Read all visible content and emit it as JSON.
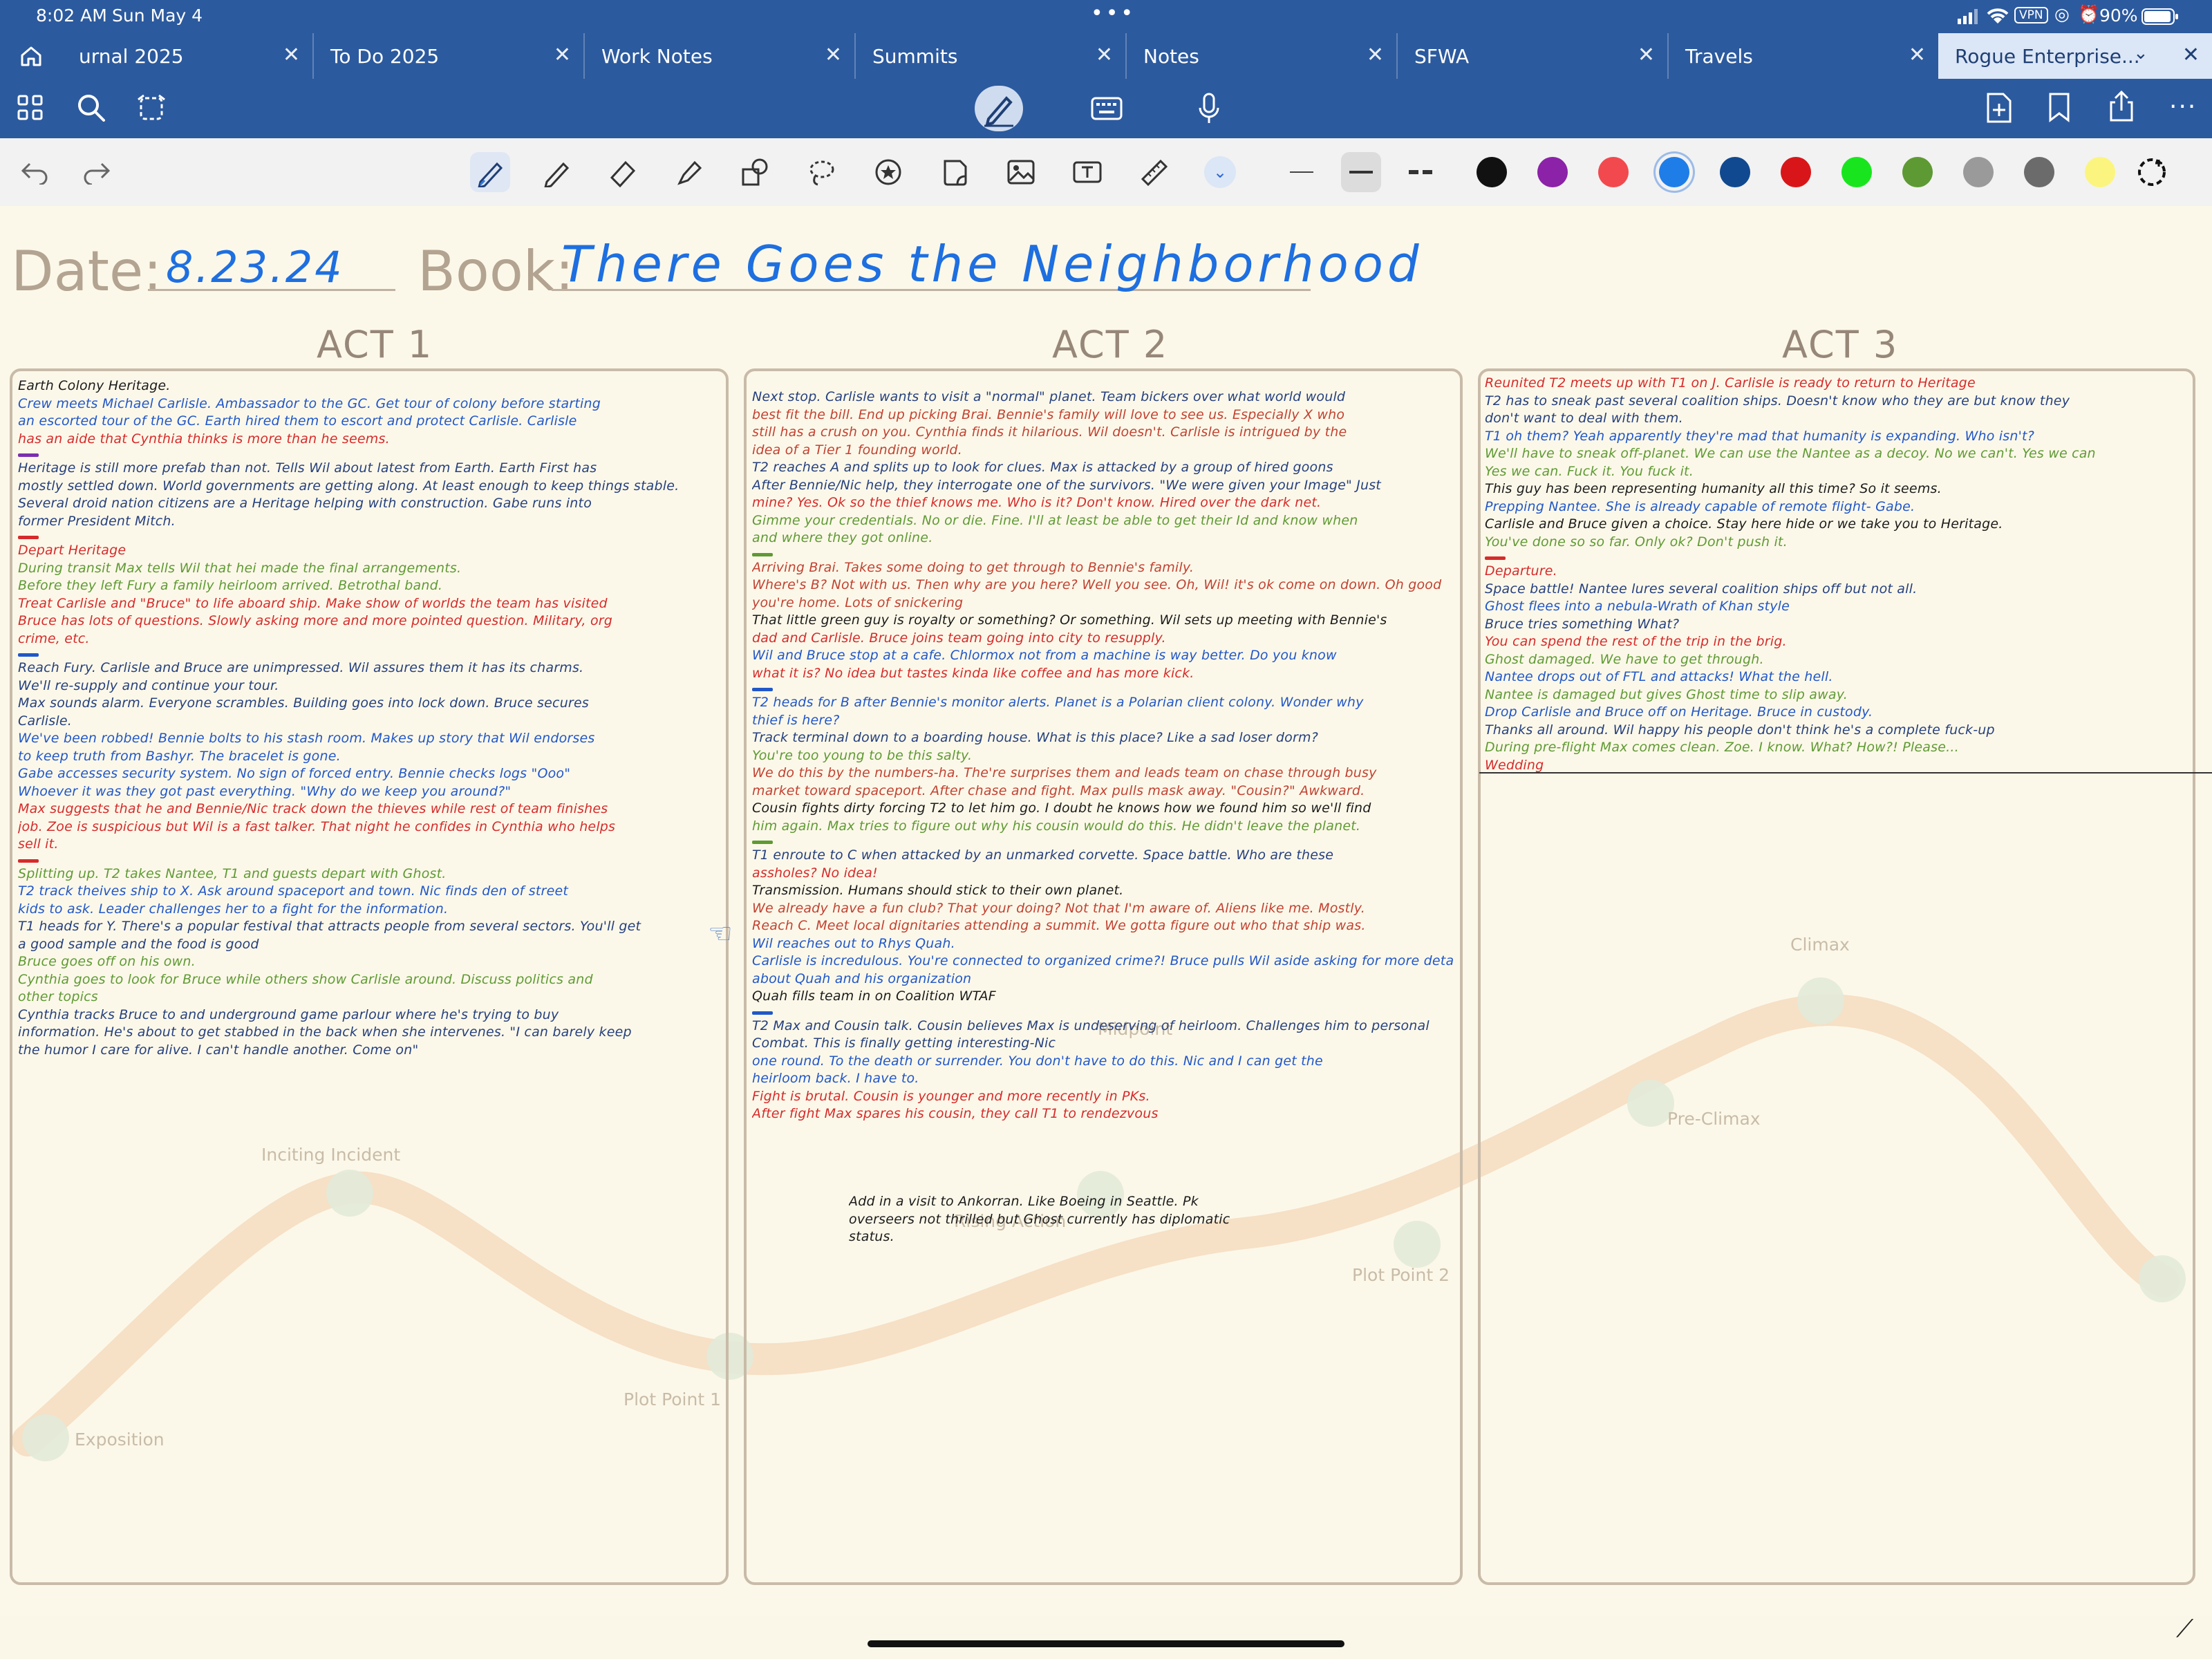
{
  "status": {
    "time": "8:02 AM",
    "date": "Sun May 4",
    "vpn": "VPN",
    "battery": "90%"
  },
  "tabs": [
    {
      "label": "urnal 2025"
    },
    {
      "label": "To Do 2025"
    },
    {
      "label": "Work Notes"
    },
    {
      "label": "Summits"
    },
    {
      "label": "Notes"
    },
    {
      "label": "SFWA"
    },
    {
      "label": "Travels"
    },
    {
      "label": "Rogue Enterprise..."
    }
  ],
  "colors": {
    "swatches": [
      "#111111",
      "#8b22a8",
      "#f2494e",
      "#1f7de8",
      "#10498f",
      "#d81619",
      "#19e51f",
      "#5e9a33",
      "#9a9a9a",
      "#6b6b6b",
      "#fbf57f"
    ]
  },
  "page": {
    "date_label": "Date:",
    "date_value": "8.23.24",
    "book_label": "Book:",
    "book_value": "There Goes the Neighborhood",
    "acts": [
      {
        "title": "ACT 1"
      },
      {
        "title": "ACT 2"
      },
      {
        "title": "ACT 3"
      }
    ],
    "arc_labels": {
      "exposition": "Exposition",
      "inciting": "Inciting Incident",
      "plot1": "Plot Point 1",
      "rising": "Rising Action",
      "midpoint": "Midpoint",
      "plot2": "Plot Point 2",
      "preclimax": "Pre-Climax",
      "climax": "Climax"
    }
  },
  "act1_lines": [
    {
      "c": "k",
      "t": "Earth Colony Heritage."
    },
    {
      "c": "b",
      "t": "Crew meets Michael Carlisle. Ambassador to the GC. Get tour of colony before starting"
    },
    {
      "c": "b",
      "t": "an escorted tour of the GC. Earth hired them to escort and protect Carlisle. Carlisle"
    },
    {
      "c": "r",
      "t": "has an aide that Cynthia thinks is more than he seems."
    },
    {
      "d": "#7b2fb0"
    },
    {
      "c": "n",
      "t": "Heritage is still more prefab than not. Tells Wil about latest from Earth. Earth First has"
    },
    {
      "c": "n",
      "t": "mostly settled down. World governments are getting along. At least enough to keep things stable."
    },
    {
      "c": "n",
      "t": "Several droid nation citizens are a Heritage helping with construction. Gabe runs into"
    },
    {
      "c": "n",
      "t": "former President Mitch."
    },
    {
      "d": "#d62b2b"
    },
    {
      "c": "r",
      "t": "Depart Heritage"
    },
    {
      "c": "g",
      "t": "During transit Max tells Wil that hei made the final arrangements."
    },
    {
      "c": "g",
      "t": "Before they left Fury a family heirloom arrived. Betrothal band."
    },
    {
      "c": "r",
      "t": "Treat Carlisle and \"Bruce\" to life aboard ship. Make show of worlds the team has visited"
    },
    {
      "c": "r",
      "t": "Bruce has lots of questions. Slowly asking more and more pointed question. Military, org"
    },
    {
      "c": "r",
      "t": "crime, etc."
    },
    {
      "d": "#2157c9"
    },
    {
      "c": "n",
      "t": "Reach Fury. Carlisle and Bruce are unimpressed. Wil assures them it has its charms."
    },
    {
      "c": "n",
      "t": "We'll re-supply and continue your tour."
    },
    {
      "c": "n",
      "t": "Max sounds alarm. Everyone scrambles. Building goes into lock down. Bruce secures"
    },
    {
      "c": "n",
      "t": "Carlisle."
    },
    {
      "c": "b",
      "t": "We've been robbed! Bennie bolts to his stash room. Makes up story that Wil endorses"
    },
    {
      "c": "b",
      "t": "to keep truth from Bashyr. The bracelet is gone."
    },
    {
      "c": "b",
      "t": "Gabe accesses security system. No sign of forced entry. Bennie checks logs \"Ooo\""
    },
    {
      "c": "b",
      "t": "Whoever it was they got past everything. \"Why do we keep you around?\""
    },
    {
      "c": "r",
      "t": "Max suggests that he and Bennie/Nic track down the thieves while rest of team finishes"
    },
    {
      "c": "r",
      "t": "job. Zoe is suspicious but Wil is a fast talker. That night he confides in Cynthia who helps"
    },
    {
      "c": "r",
      "t": "sell it."
    },
    {
      "d": "#d62b2b"
    },
    {
      "c": "g",
      "t": "Splitting up. T2 takes Nantee, T1 and guests depart with Ghost."
    },
    {
      "c": "b",
      "t": "T2 track theives ship to X. Ask around spaceport and town. Nic finds den of street"
    },
    {
      "c": "b",
      "t": "kids to ask. Leader challenges her to a fight for the information."
    },
    {
      "c": "n",
      "t": "T1 heads for Y. There's a popular festival that attracts people from several sectors. You'll get"
    },
    {
      "c": "n",
      "t": "a good sample and the food is good"
    },
    {
      "c": "g",
      "t": "Bruce goes off on his own."
    },
    {
      "c": "g",
      "t": "Cynthia goes to look for Bruce while others show Carlisle around. Discuss politics and"
    },
    {
      "c": "g",
      "t": "other topics"
    },
    {
      "c": "n",
      "t": "Cynthia tracks Bruce to and underground game parlour where he's trying to buy"
    },
    {
      "c": "n",
      "t": "information. He's about to get stabbed in the back when she intervenes. \"I can barely keep"
    },
    {
      "c": "n",
      "t": "the humor I care for alive. I can't handle another. Come on\""
    }
  ],
  "act2_lines": [
    {
      "c": "n",
      "t": "Next stop. Carlisle wants to visit a \"normal\" planet. Team bickers over what world would"
    },
    {
      "c": "m",
      "t": "best fit the bill. End up picking Brai. Bennie's family will love to see us. Especially X who"
    },
    {
      "c": "m",
      "t": "still has a crush on you. Cynthia finds it hilarious. Wil doesn't. Carlisle is intrigued by the"
    },
    {
      "c": "m",
      "t": "idea of a Tier 1 founding world."
    },
    {
      "c": "n",
      "t": "T2 reaches A and splits up to look for clues. Max is attacked by a group of hired goons"
    },
    {
      "c": "n",
      "t": "After Bennie/Nic help, they interrogate one of the survivors. \"We were given your Image\" Just"
    },
    {
      "c": "r",
      "t": "mine? Yes. Ok so the thief knows me. Who is it? Don't know. Hired over the dark net."
    },
    {
      "c": "g",
      "t": "Gimme your credentials. No or die. Fine. I'll at least be able to get their Id and know when"
    },
    {
      "c": "g",
      "t": "and where they got online."
    },
    {
      "d": "#5f9a34"
    },
    {
      "c": "m",
      "t": "Arriving Brai. Takes some doing to get through to Bennie's family."
    },
    {
      "c": "m",
      "t": "Where's B? Not with us. Then why are you here? Well you see. Oh, Wil! it's ok come on down. Oh good"
    },
    {
      "c": "m",
      "t": "you're home. Lots of snickering"
    },
    {
      "c": "k",
      "t": "That little green guy is royalty or something? Or something. Wil sets up meeting with Bennie's"
    },
    {
      "c": "r",
      "t": "dad and Carlisle. Bruce joins team going into city to resupply."
    },
    {
      "c": "b",
      "t": "Wil and Bruce stop at a cafe. Chlormox not from a machine is way better. Do you know"
    },
    {
      "c": "r",
      "t": "what it is? No idea but tastes kinda like coffee and has more kick."
    },
    {
      "d": "#2157c9"
    },
    {
      "c": "b",
      "t": "T2 heads for B after Bennie's monitor alerts. Planet is a Polarian client colony. Wonder why"
    },
    {
      "c": "b",
      "t": "thief is here?"
    },
    {
      "c": "n",
      "t": "Track terminal down to a boarding house. What is this place? Like a sad loser dorm?"
    },
    {
      "c": "g",
      "t": "You're too young to be this salty."
    },
    {
      "c": "m",
      "t": "We do this by the numbers-ha. The're surprises them and leads team on chase through busy"
    },
    {
      "c": "m",
      "t": "market toward spaceport.   After chase and fight. Max pulls mask away. \"Cousin?\" Awkward."
    },
    {
      "c": "k",
      "t": "Cousin fights dirty forcing T2 to let him go. I doubt he knows how we found him so we'll find"
    },
    {
      "c": "g",
      "t": "him again. Max tries to figure out why his cousin would do this. He didn't leave the planet."
    },
    {
      "d": "#5f9a34"
    },
    {
      "c": "n",
      "t": "T1 enroute to C when attacked by an unmarked corvette. Space battle. Who are these"
    },
    {
      "c": "r",
      "t": "assholes? No idea!"
    },
    {
      "c": "k",
      "t": "Transmission. Humans should stick to their own planet."
    },
    {
      "c": "m",
      "t": "We already have a fun club? That your doing? Not that I'm aware of. Aliens like me. Mostly."
    },
    {
      "c": "m",
      "t": "Reach C. Meet local dignitaries attending a summit. We gotta figure out who that ship was."
    },
    {
      "c": "b",
      "t": "Wil reaches out to Rhys Quah."
    },
    {
      "c": "b",
      "t": "Carlisle is incredulous. You're connected to organized crime?! Bruce pulls Wil aside asking for more details"
    },
    {
      "c": "b",
      "t": "about Quah and his organization"
    },
    {
      "c": "k",
      "t": "Quah fills team in on Coalition WTAF"
    },
    {
      "d": "#2157c9"
    },
    {
      "c": "n",
      "t": "T2 Max and Cousin talk. Cousin believes Max is undeserving of heirloom. Challenges him to personal"
    },
    {
      "c": "n",
      "t": "Combat. This is finally getting interesting-Nic"
    },
    {
      "c": "b",
      "t": "one round. To the death or surrender. You don't have to do this. Nic and I can get the"
    },
    {
      "c": "b",
      "t": "heirloom back. I have to."
    },
    {
      "c": "r",
      "t": "Fight is brutal. Cousin is younger and more recently in PKs."
    },
    {
      "c": "r",
      "t": "After fight Max spares his cousin, they call T1 to rendezvous"
    }
  ],
  "act2_bottom_note": [
    {
      "c": "k",
      "t": "Add in a visit to Ankorran. Like Boeing in Seattle. Pk"
    },
    {
      "c": "k",
      "t": "overseers not thrilled but Ghost currently has diplomatic"
    },
    {
      "c": "k",
      "t": "status."
    }
  ],
  "act3_lines": [
    {
      "c": "r",
      "t": "Reunited T2 meets up with T1 on J. Carlisle is ready to return to Heritage"
    },
    {
      "c": "n",
      "t": "T2 has to sneak past several coalition ships. Doesn't know who they are but know they"
    },
    {
      "c": "n",
      "t": "don't want to deal with them."
    },
    {
      "c": "b",
      "t": "T1 oh them? Yeah apparently they're mad that humanity is expanding. Who isn't?"
    },
    {
      "c": "g",
      "t": "We'll have to sneak off-planet. We can use the Nantee as a decoy. No we can't. Yes we can"
    },
    {
      "c": "g",
      "t": "Yes we can. Fuck it. You fuck it."
    },
    {
      "c": "k",
      "t": "This guy has been representing humanity all this time? So it seems."
    },
    {
      "c": "b",
      "t": "Prepping Nantee. She is already capable of remote flight- Gabe."
    },
    {
      "c": "k",
      "t": "Carlisle and Bruce given a choice. Stay here hide or we take you to Heritage."
    },
    {
      "c": "g",
      "t": "You've done so so far. Only ok? Don't push it."
    },
    {
      "d": "#d62b2b"
    },
    {
      "c": "r",
      "t": "Departure."
    },
    {
      "c": "n",
      "t": "Space battle! Nantee lures several coalition ships off but not all."
    },
    {
      "c": "b",
      "t": "Ghost flees into a nebula-Wrath of Khan style"
    },
    {
      "c": "n",
      "t": "Bruce tries something          What?"
    },
    {
      "c": "r",
      "t": "You can spend the rest of the trip in the brig."
    },
    {
      "c": "g",
      "t": "Ghost damaged.  We have to get through."
    },
    {
      "c": "b",
      "t": "Nantee drops out of FTL and attacks!  What the hell."
    },
    {
      "c": "g",
      "t": "Nantee is damaged but gives Ghost time to slip away."
    },
    {
      "c": "b",
      "t": "Drop Carlisle and Bruce off on Heritage. Bruce in custody."
    },
    {
      "c": "n",
      "t": "Thanks all around. Wil happy his people don't think he's a complete fuck-up"
    },
    {
      "c": "g",
      "t": "During pre-flight Max comes clean. Zoe. I know. What? How?! Please..."
    },
    {
      "c": "r",
      "t": "Wedding"
    }
  ]
}
